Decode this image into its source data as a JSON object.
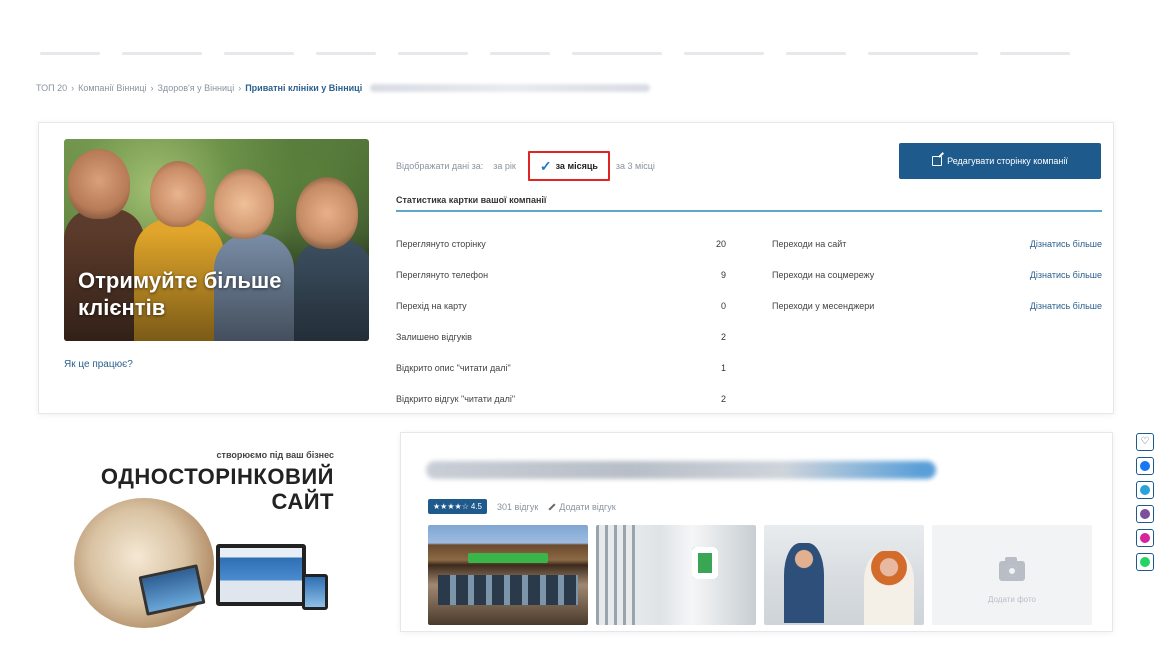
{
  "breadcrumb": {
    "items": [
      "ТОП 20",
      "Компанії Вінниці",
      "Здоров'я у Вінниці"
    ],
    "active": "Приватні клініки у Вінниці",
    "separator": "›"
  },
  "promo": {
    "title": "Отримуйте більше клієнтів",
    "how_link": "Як це працює?"
  },
  "stats": {
    "filter_label": "Відображати дані за:",
    "filter_options": [
      "за рік",
      "за місяць",
      "за 3 місці"
    ],
    "filter_selected": "за місяць",
    "edit_button": "Редагувати сторінку компанії",
    "header": "Статистика картки вашої компанії",
    "left_rows": [
      {
        "label": "Переглянуто сторінку",
        "value": "20"
      },
      {
        "label": "Переглянуто телефон",
        "value": "9"
      },
      {
        "label": "Перехід на карту",
        "value": "0"
      },
      {
        "label": "Залишено відгуків",
        "value": "2"
      },
      {
        "label": "Відкрито опис \"читати далі\"",
        "value": "1"
      },
      {
        "label": "Відкрито відгук \"читати далі\"",
        "value": "2"
      }
    ],
    "right_rows": [
      {
        "label": "Переходи на сайт",
        "link": "Дізнатись більше"
      },
      {
        "label": "Переходи на соцмережу",
        "link": "Дізнатись більше"
      },
      {
        "label": "Переходи у месенджери",
        "link": "Дізнатись більше"
      }
    ]
  },
  "promo2": {
    "tag": "створюємо під ваш бізнес",
    "line1": "ОДНОСТОРІНКОВИЙ",
    "line2": "САЙТ"
  },
  "company": {
    "rating": "4.5",
    "reviews": "301 відгук",
    "add_review": "Додати відгук",
    "add_photo": "Додати фото"
  },
  "share": {
    "icons": [
      "heart-icon",
      "facebook-icon",
      "telegram-icon",
      "viber-icon",
      "instagram-icon",
      "whatsapp-icon"
    ],
    "colors": [
      "#1f5a8c",
      "#1877f2",
      "#2aa3d8",
      "#7b519d",
      "#d6249f",
      "#25d366"
    ]
  }
}
